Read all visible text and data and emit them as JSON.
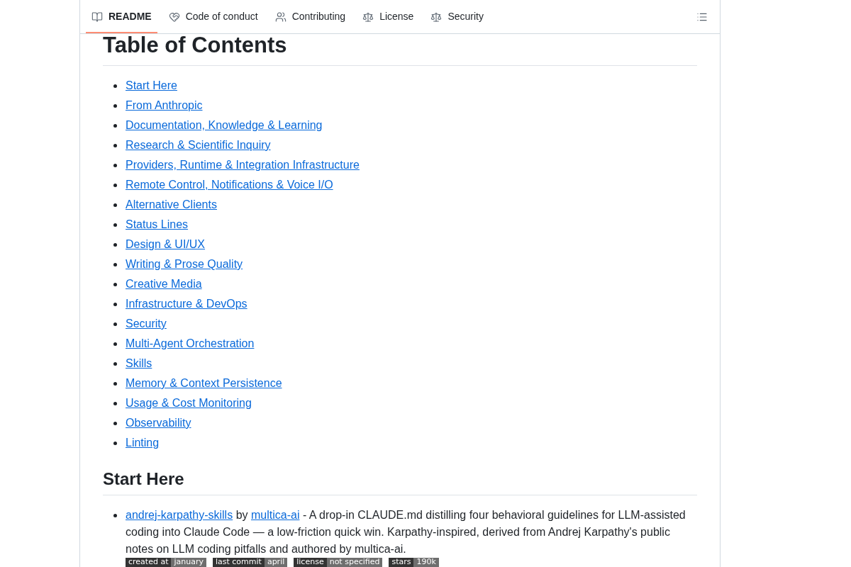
{
  "tabs": [
    {
      "label": "README",
      "selected": true
    },
    {
      "label": "Code of conduct",
      "selected": false
    },
    {
      "label": "Contributing",
      "selected": false
    },
    {
      "label": "License",
      "selected": false
    },
    {
      "label": "Security",
      "selected": false
    }
  ],
  "toc": {
    "title": "Table of Contents",
    "items": [
      "Start Here",
      "From Anthropic",
      "Documentation, Knowledge & Learning",
      "Research & Scientific Inquiry",
      "Providers, Runtime & Integration Infrastructure",
      "Remote Control, Notifications & Voice I/O",
      "Alternative Clients",
      "Status Lines",
      "Design & UI/UX",
      "Writing & Prose Quality",
      "Creative Media",
      "Infrastructure & DevOps",
      "Security",
      "Multi-Agent Orchestration",
      "Skills",
      "Memory & Context Persistence",
      "Usage & Cost Monitoring",
      "Observability",
      "Linting"
    ]
  },
  "sections": [
    {
      "title": "Start Here",
      "entries": [
        {
          "segments": [
            {
              "kind": "repo_link",
              "text": "andrej-karpathy-skills"
            },
            {
              "kind": "text",
              "text": "by"
            },
            {
              "kind": "author_link",
              "text": "multica-ai"
            },
            {
              "kind": "text",
              "text": "- A drop-in CLAUDE.md distilling four behavioral guidelines for LLM-assisted coding into Claude Code — a low-friction quick win. Karpathy-inspired, derived from Andrej Karpathy's public notes on LLM coding pitfalls and authored by multica-ai."
            }
          ],
          "badges": [
            {
              "label": "created at",
              "value": "january"
            },
            {
              "label": "last commit",
              "value": "april"
            },
            {
              "label": "license",
              "value": "not specified"
            },
            {
              "label": "stars",
              "value": "190k"
            }
          ]
        }
      ]
    }
  ]
}
